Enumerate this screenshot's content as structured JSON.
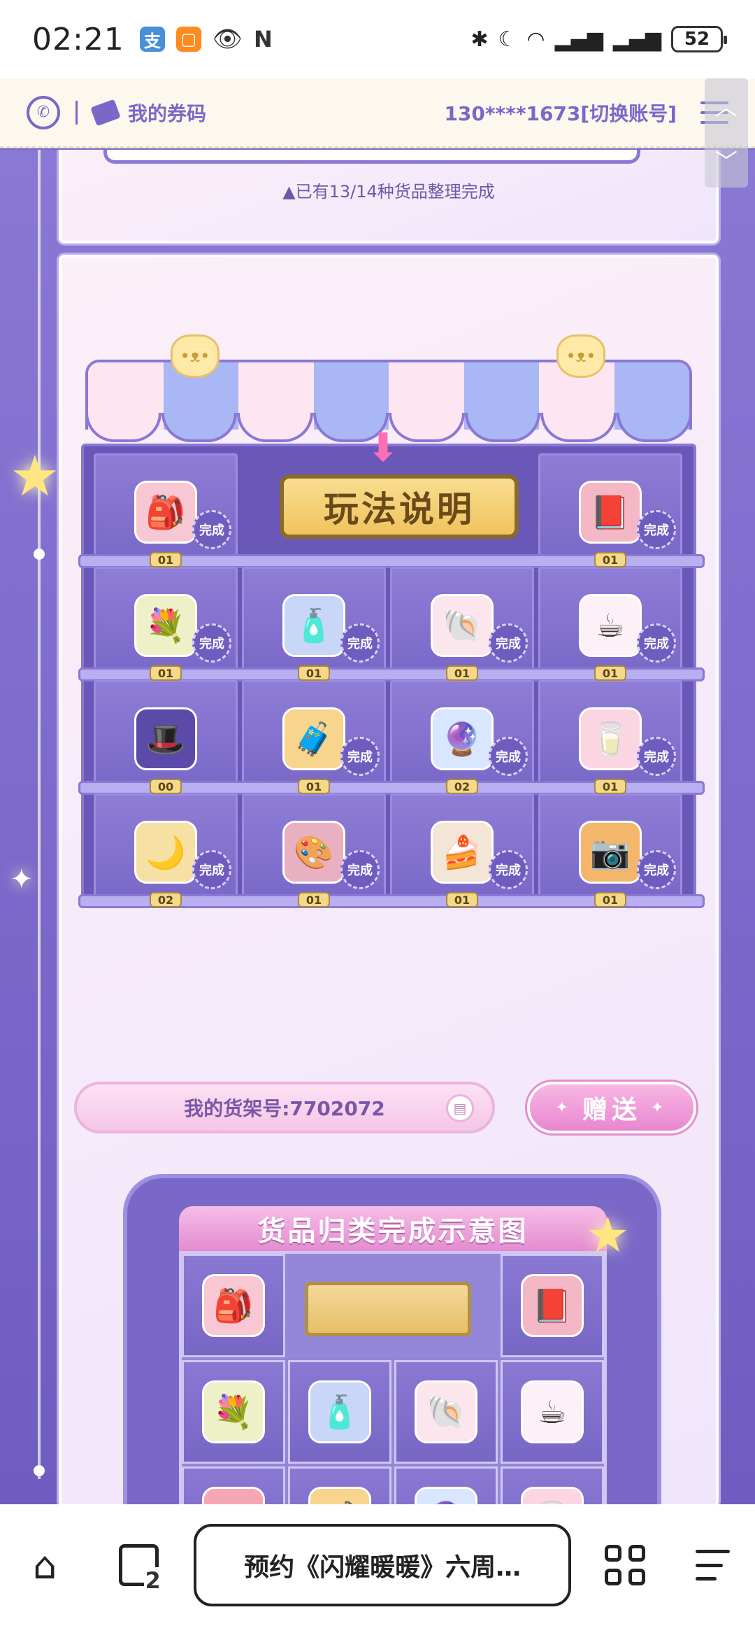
{
  "status_bar": {
    "time": "02:21",
    "battery": "52",
    "left_icons": [
      "alipay-icon",
      "taobao-icon",
      "eye-icon",
      "nfc-icon"
    ],
    "right_icons": [
      "bluetooth-icon",
      "moon-icon",
      "wifi-icon",
      "signal-icon",
      "signal-icon"
    ]
  },
  "header": {
    "coupon_label": "我的券码",
    "account": "130****1673[切换账号]"
  },
  "progress_text": "▲已有13/14种货品整理完成",
  "shelf": {
    "rules_sign": "玩法说明",
    "done_label": "完成",
    "rows": [
      [
        {
          "name": "bunny-backpack-item",
          "icon": "🎒",
          "color": "#f7c7d4",
          "count": "01",
          "done": true
        },
        {
          "name": "photo-album-item",
          "icon": "📕",
          "color": "#f3b7c6",
          "count": "01",
          "done": true
        }
      ],
      [
        {
          "name": "flower-basket-item",
          "icon": "💐",
          "color": "#eef0c8",
          "count": "01",
          "done": true
        },
        {
          "name": "perfume-bottle-item",
          "icon": "🧴",
          "color": "#c8d7f7",
          "count": "01",
          "done": true
        },
        {
          "name": "seashell-item",
          "icon": "🐚",
          "color": "#fbe6ee",
          "count": "01",
          "done": true
        },
        {
          "name": "bunny-mug-item",
          "icon": "☕",
          "color": "#fdf0f6",
          "count": "01",
          "done": true
        }
      ],
      [
        {
          "name": "cat-hat-item",
          "icon": "🎩",
          "color": "#5b4aa8",
          "count": "00",
          "done": false
        },
        {
          "name": "suitcase-item",
          "icon": "🧳",
          "color": "#f7d58c",
          "count": "01",
          "done": true
        },
        {
          "name": "crystal-ball-item",
          "icon": "🔮",
          "color": "#d8e7ff",
          "count": "02",
          "done": true
        },
        {
          "name": "milk-carton-item",
          "icon": "🥛",
          "color": "#fbd6e2",
          "count": "01",
          "done": true
        }
      ],
      [
        {
          "name": "moon-pillow-item",
          "icon": "🌙",
          "color": "#f7e0a4",
          "count": "02",
          "done": true
        },
        {
          "name": "eyeshadow-palette-item",
          "icon": "🎨",
          "color": "#e8b0c0",
          "count": "01",
          "done": true
        },
        {
          "name": "cake-slice-item",
          "icon": "🍰",
          "color": "#f4e6d6",
          "count": "01",
          "done": true
        },
        {
          "name": "camera-item",
          "icon": "📷",
          "color": "#f4b66a",
          "count": "01",
          "done": true
        }
      ]
    ]
  },
  "shelf_id": "我的货架号:7702072",
  "gift_button": "赠送",
  "diagram": {
    "title": "货品归类完成示意图",
    "rows": [
      [
        {
          "icon": "🎒",
          "color": "#f7c7d4"
        },
        {
          "icon": "📕",
          "color": "#f3b7c6"
        }
      ],
      [
        {
          "icon": "💐",
          "color": "#eef0c8"
        },
        {
          "icon": "🧴",
          "color": "#c8d7f7"
        },
        {
          "icon": "🐚",
          "color": "#fbe6ee"
        },
        {
          "icon": "☕",
          "color": "#fdf0f6"
        }
      ],
      [
        {
          "icon": "🎩",
          "color": "#f5a7b6"
        },
        {
          "icon": "🧳",
          "color": "#f7d58c"
        },
        {
          "icon": "🔮",
          "color": "#d8e7ff"
        },
        {
          "icon": "🥛",
          "color": "#fbd6e2"
        }
      ],
      [
        {
          "icon": "🌙",
          "color": "#f7e0a4"
        },
        {
          "icon": "🎨",
          "color": "#e8b0c0"
        },
        {
          "icon": "🍰",
          "color": "#f4e6d6"
        },
        {
          "icon": "📷",
          "color": "#f4b66a"
        }
      ]
    ]
  },
  "bottom_nav": {
    "tab_count": "2",
    "url_text": "预约《闪耀暖暖》六周…"
  }
}
